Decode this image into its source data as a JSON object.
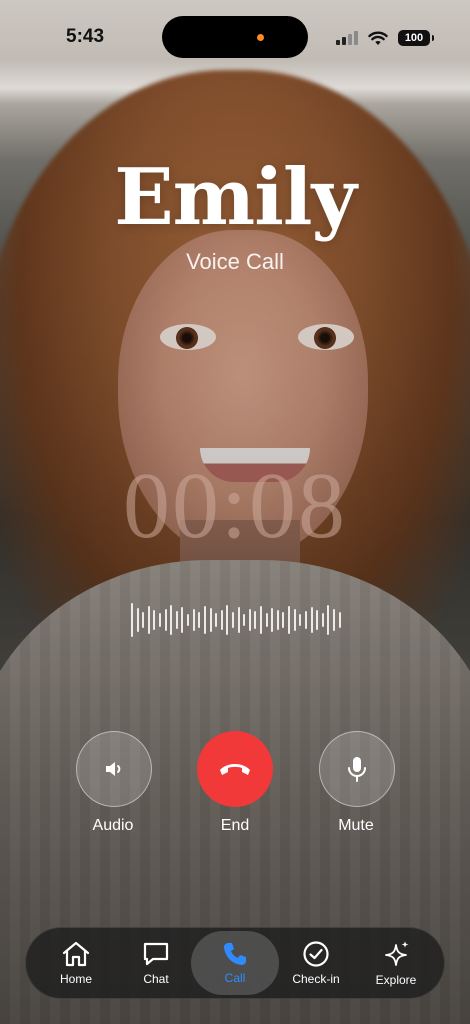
{
  "status_bar": {
    "time": "5:43",
    "battery": "100"
  },
  "caller": {
    "name": "Emily",
    "call_type": "Voice Call",
    "duration": "00:08"
  },
  "controls": [
    {
      "label": "Audio",
      "icon": "speaker-icon"
    },
    {
      "label": "End",
      "icon": "end-call-icon",
      "color": "#f1393a"
    },
    {
      "label": "Mute",
      "icon": "microphone-icon"
    }
  ],
  "tabbar": {
    "tabs": [
      {
        "label": "Home",
        "icon": "home-icon"
      },
      {
        "label": "Chat",
        "icon": "chat-icon"
      },
      {
        "label": "Call",
        "icon": "phone-icon",
        "active": true
      },
      {
        "label": "Check-in",
        "icon": "check-circle-icon"
      },
      {
        "label": "Explore",
        "icon": "sparkle-icon"
      }
    ],
    "active_color": "#2f8bff"
  }
}
